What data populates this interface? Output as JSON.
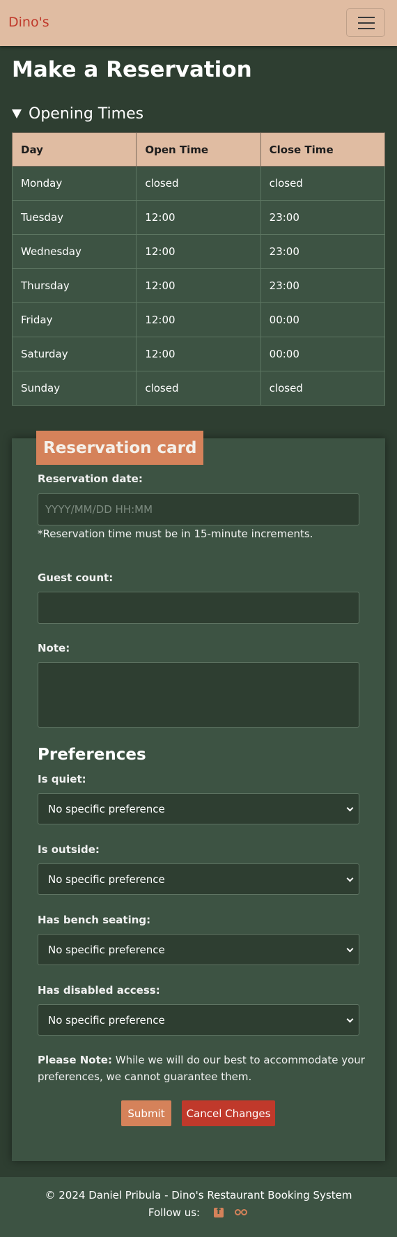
{
  "navbar": {
    "brand": "Dino's"
  },
  "page": {
    "title": "Make a Reservation"
  },
  "opening_times": {
    "summary": "Opening Times",
    "headers": [
      "Day",
      "Open Time",
      "Close Time"
    ],
    "rows": [
      [
        "Monday",
        "closed",
        "closed"
      ],
      [
        "Tuesday",
        "12:00",
        "23:00"
      ],
      [
        "Wednesday",
        "12:00",
        "23:00"
      ],
      [
        "Thursday",
        "12:00",
        "23:00"
      ],
      [
        "Friday",
        "12:00",
        "00:00"
      ],
      [
        "Saturday",
        "12:00",
        "00:00"
      ],
      [
        "Sunday",
        "closed",
        "closed"
      ]
    ]
  },
  "card": {
    "title": "Reservation card",
    "date_label": "Reservation date:",
    "date_placeholder": "YYYY/MM/DD HH:MM",
    "date_hint": "*Reservation time must be in 15-minute increments.",
    "guest_label": "Guest count:",
    "guest_value": "",
    "note_label": "Note:",
    "note_value": "",
    "prefs_title": "Preferences",
    "prefs": [
      {
        "label": "Is quiet:",
        "value": "No specific preference"
      },
      {
        "label": "Is outside:",
        "value": "No specific preference"
      },
      {
        "label": "Has bench seating:",
        "value": "No specific preference"
      },
      {
        "label": "Has disabled access:",
        "value": "No specific preference"
      }
    ],
    "note_bold": "Please Note:",
    "note_text": " While we will do our best to accommodate your preferences, we cannot guarantee them.",
    "submit_label": "Submit",
    "cancel_label": "Cancel Changes"
  },
  "footer": {
    "copyright": "© 2024 Daniel Pribula - Dino's Restaurant Booking System",
    "follow": "Follow us:"
  },
  "colors": {
    "background": "#2e3e31",
    "card": "#3d5343",
    "accent": "#d5825a",
    "navbar": "#e0bca2",
    "cancel": "#c0392b"
  },
  "icons": [
    "hamburger-menu-icon",
    "disclosure-triangle-icon",
    "chevron-down-icon",
    "facebook-icon",
    "tripadvisor-icon"
  ]
}
